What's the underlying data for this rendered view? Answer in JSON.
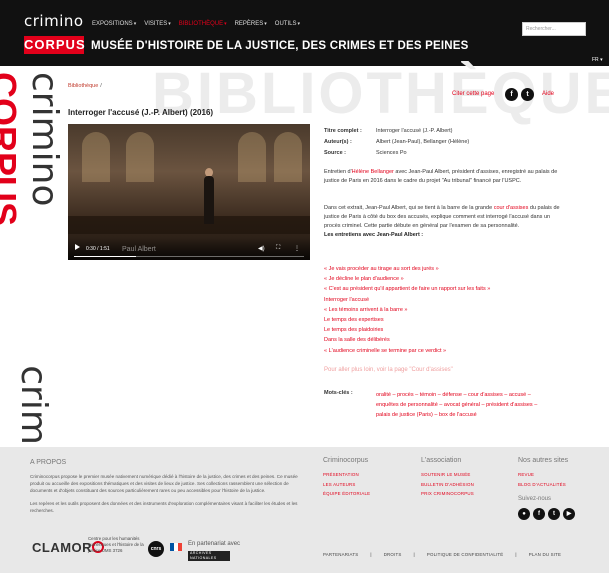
{
  "header": {
    "logo_top": "crimino",
    "logo_bottom": "CORPUS",
    "nav": [
      {
        "label": "EXPOSITIONS",
        "active": false
      },
      {
        "label": "VISITES",
        "active": false
      },
      {
        "label": "BIBLIOTHÈQUE",
        "active": true
      },
      {
        "label": "REPÈRES",
        "active": false
      },
      {
        "label": "OUTILS",
        "active": false
      }
    ],
    "site_title": "MUSÉE D'HISTOIRE DE LA JUSTICE, DES CRIMES ET DES PEINES",
    "search_placeholder": "Rechercher...",
    "lang": "FR"
  },
  "watermark": "BIBLIOTHÈQUE",
  "side_watermark": {
    "top": "crimino",
    "bottom": "CORPUS",
    "second": "crimino"
  },
  "breadcrumb": {
    "item": "Bibliothèque",
    "sep": "/"
  },
  "actions": {
    "cite": "Citer cette page",
    "fb": "f",
    "tw": "t",
    "help": "Aide"
  },
  "page_title": "Interroger l'accusé (J.-P. Albert) (2016)",
  "video": {
    "time": "0:30 / 1:51",
    "label": "Paul Albert",
    "progress_fraction": 0.27,
    "volume_icon": "volume-icon",
    "fullscreen_icon": "fullscreen-icon",
    "more_icon": "more-icon"
  },
  "meta": {
    "title_label": "Titre complet :",
    "title_value": "Interroger l'accusé (J.-P. Albert)",
    "author_label": "Auteur(s) :",
    "author_value": "Albert (Jean-Paul), Bellanger (Hélène)",
    "source_label": "Source :",
    "source_value": "Sciences Po"
  },
  "para1": {
    "pre": "Entretien d'",
    "link": "Hélène Bellanger",
    "post": " avec Jean-Paul Albert, président d'assises, enregistré au palais de justice de Paris en 2016 dans le cadre du projet \"Au tribunal\" financé par l'USPC."
  },
  "para2": {
    "pre": "Dans cet extrait, Jean-Paul Albert, qui se tient à la barre de la grande ",
    "link": "cour d'assises",
    "post": " du palais de justice de Paris à côté du box des accusés, explique comment est interrogé l'accusé dans un procès criminel. Cette partie débute en général par l'examen de sa personnalité.",
    "bold": "Les entretiens avec Jean-Paul Albert :"
  },
  "links": [
    "« Je vais procéder au tirage au sort des jurés »",
    "« Je décline le plan d'audience »",
    "« C'est au président qu'il appartient de faire un rapport sur les faits »",
    "Interroger l'accusé",
    "« Les témoins arrivent à la barre »",
    "Le temps des expertises",
    "Le temps des plaidoiries",
    "Dans la salle des délibérés",
    "« L'audience criminelle se termine par ce verdict »"
  ],
  "more_link": "Pour aller plus loin, voir la page \"Cour d'assises\"",
  "keywords": {
    "label": "Mots-clés :",
    "value": "oralité – procès – témoin – défense – cour d'assises – accusé – enquêtes de personnalité – avocat général – président d'assises – palais de justice (Paris) – box de l'accusé"
  },
  "footer": {
    "about_title": "A PROPOS",
    "about_p1": "Criminocorpus propose le premier musée nativement numérique dédié à l'histoire de la justice, des crimes et des peines. Ce musée produit ou accueille des expositions thématiques et des visites de lieux de justice. Ses collections rassemblent une sélection de documents et d'objets constituant des sources particulièrement rares ou peu accessibles pour l'histoire de la justice.",
    "about_p2": "Les repères et les outils proposent des données et des instruments d'exploration complémentaires visant à faciliter les études et les recherches.",
    "col1_title": "Criminocorpus",
    "col1_links": [
      "PRÉSENTATION",
      "LES AUTEURS",
      "ÉQUIPE ÉDITORIALE"
    ],
    "col2_title": "L'association",
    "col2_links": [
      "SOUTENIR LE MUSÉE",
      "BULLETIN D'ADHÉSION",
      "PRIX CRIMINOCORPUS"
    ],
    "col3_title": "Nos autres sites",
    "col3_links": [
      "REVUE",
      "BLOG D'ACTUALITÉS"
    ],
    "follow": "Suivez-nous",
    "social": [
      "●",
      "f",
      "t",
      "▶"
    ],
    "clamor": "CLAMOR",
    "clamor_sub": "Centre pour les humanités numériques et l'histoire de la justice UMS 3726",
    "cnrs": "cnrs",
    "partner": "En partenariat avec",
    "archives": "ARCHIVES NATIONALES",
    "bottom_nav": [
      "PARTENARIATS",
      "DROITS",
      "POLITIQUE DE CONFIDENTIALITÉ",
      "PLAN DU SITE"
    ],
    "pipe": "|"
  }
}
